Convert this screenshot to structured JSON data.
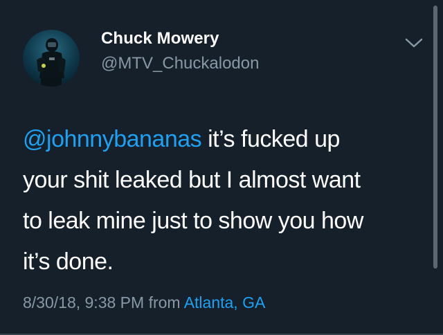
{
  "tweet": {
    "author": {
      "name": "Chuck Mowery",
      "handle": "@MTV_Chuckalodon"
    },
    "text": {
      "mention": "@johnnybananas",
      "line1_rest": " it’s fucked up",
      "line2": "your shit leaked but I almost want",
      "line3": "to leak mine just to show you how",
      "line4": "it’s done."
    },
    "timestamp": "8/30/18, 9:38 PM",
    "from_label": "from",
    "location": "Atlanta, GA"
  },
  "colors": {
    "background": "#15202b",
    "text": "#ffffff",
    "secondary_text": "#8899a6",
    "link": "#1da1f2"
  },
  "icons": {
    "menu": "chevron-down-icon",
    "avatar": "scuba-diver-photo"
  }
}
